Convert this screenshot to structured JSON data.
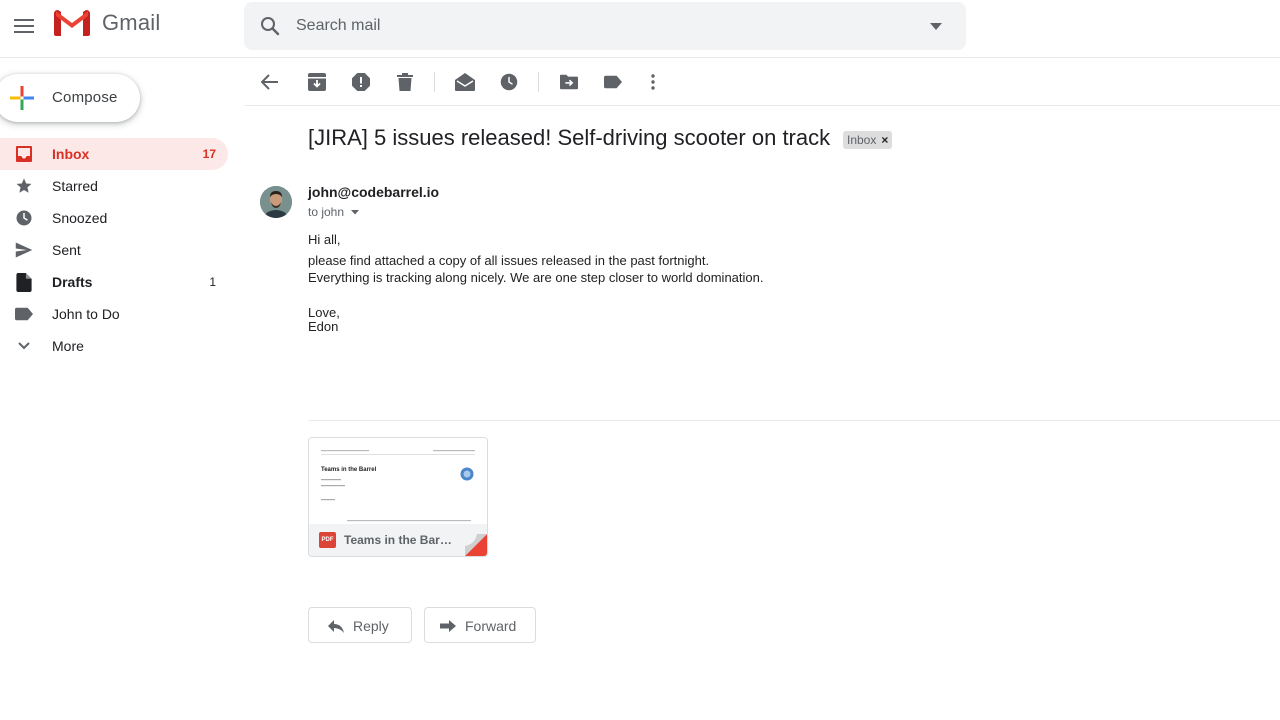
{
  "header": {
    "app_name": "Gmail",
    "search_placeholder": "Search mail"
  },
  "sidebar": {
    "compose_label": "Compose",
    "items": [
      {
        "label": "Inbox",
        "count": "17",
        "icon": "inbox-icon"
      },
      {
        "label": "Starred",
        "count": "",
        "icon": "star-icon"
      },
      {
        "label": "Snoozed",
        "count": "",
        "icon": "clock-icon"
      },
      {
        "label": "Sent",
        "count": "",
        "icon": "send-icon"
      },
      {
        "label": "Drafts",
        "count": "1",
        "icon": "draft-icon"
      },
      {
        "label": "John to Do",
        "count": "",
        "icon": "label-icon"
      },
      {
        "label": "More",
        "count": "",
        "icon": "chevron-down-icon"
      }
    ]
  },
  "toolbar": {
    "icons": [
      "back-arrow-icon",
      "archive-icon",
      "report-spam-icon",
      "delete-icon",
      "mark-unread-icon",
      "snooze-icon",
      "move-to-icon",
      "label-as-icon",
      "more-vert-icon"
    ]
  },
  "message": {
    "subject": "[JIRA] 5 issues released! Self-driving scooter on track",
    "label_chip": "Inbox",
    "label_chip_close": "×",
    "sender": "john@codebarrel.io",
    "recipient": "to john",
    "body": {
      "line1": "Hi all,",
      "line2": "please find attached a copy of all issues released in the past fortnight.",
      "line3": "Everything is tracking along nicely. We are one step closer to world domination.",
      "line4": "Love,",
      "line5": "Edon"
    },
    "attachment": {
      "type_badge": "PDF",
      "name": "Teams in the Barrel Release Notes.pdf",
      "preview_title": "Teams in the Barrel"
    }
  },
  "actions": {
    "reply": "Reply",
    "forward": "Forward"
  },
  "colors": {
    "accent_red": "#d93025",
    "active_bg": "#fce8e6",
    "search_bg": "#f1f3f4",
    "icon_gray": "#5f6368"
  }
}
